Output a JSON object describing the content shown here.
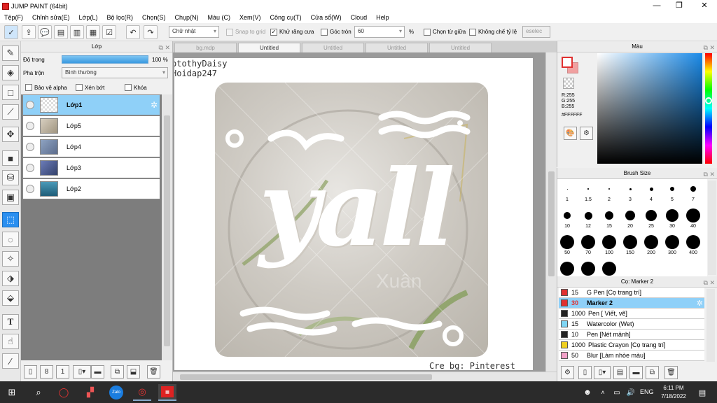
{
  "app": {
    "title": "JUMP PAINT (64bit)"
  },
  "menu": [
    "Tệp(F)",
    "Chỉnh sửa(E)",
    "Lớp(L)",
    "Bộ lọc(R)",
    "Chọn(S)",
    "Chụp(N)",
    "Màu (C)",
    "Xem(V)",
    "Công cụ(T)",
    "Cửa sổ(W)",
    "Cloud",
    "Help"
  ],
  "toolbar": {
    "shape_select": "Chữ nhật",
    "snap_label": "Snap to grid",
    "antialias_label": "Khử răng cưa",
    "round_label": "Góc tròn",
    "round_value": "60",
    "percent": "%",
    "select_center_label": "Chọn từ giữa",
    "no_ratio_label": "Không chế tỷ lệ",
    "deselect_label": "eselec"
  },
  "layer_panel": {
    "title": "Lớp",
    "opacity_label": "Độ trong",
    "opacity_value": "100 %",
    "blend_label": "Pha trộn",
    "blend_value": "Bình thường",
    "protect_alpha": "Bảo vệ alpha",
    "clip": "Xén bớt",
    "lock": "Khóa",
    "layers": [
      {
        "name": "Lớp1",
        "selected": true
      },
      {
        "name": "Lớp5",
        "selected": false
      },
      {
        "name": "Lớp4",
        "selected": false
      },
      {
        "name": "Lớp3",
        "selected": false
      },
      {
        "name": "Lớp2",
        "selected": false
      }
    ]
  },
  "tabs": [
    {
      "label": "bg.mdp",
      "active": false
    },
    {
      "label": "Untitled",
      "active": true
    },
    {
      "label": "Untitled",
      "active": false
    },
    {
      "label": "Untitled",
      "active": false
    },
    {
      "label": "Untitled",
      "active": false
    }
  ],
  "canvas": {
    "text_line1": "otothyDaisy",
    "text_line2": "Hoidap247",
    "main_text": "yall",
    "watermark": "Xuân",
    "credit": "Cre bg: Pinterest"
  },
  "color_panel": {
    "title": "Màu",
    "r": "R:255",
    "g": "G:255",
    "b": "B:255",
    "hex": "#FFFFFF"
  },
  "brush_panel": {
    "title": "Brush Size",
    "sizes": [
      "1",
      "1.5",
      "2",
      "3",
      "4",
      "5",
      "7",
      "10",
      "12",
      "15",
      "20",
      "25",
      "30",
      "40",
      "50",
      "70",
      "100",
      "150",
      "200",
      "300",
      "400"
    ]
  },
  "pen_panel": {
    "title": "Cọ: Marker 2",
    "items": [
      {
        "size": "15",
        "name": "G Pen [Cọ trang trí]",
        "color": "#e03030",
        "selected": false
      },
      {
        "size": "30",
        "name": "Marker 2",
        "color": "#e03030",
        "selected": true
      },
      {
        "size": "1000",
        "name": "Pen [ Viết, vẽ]",
        "color": "#222222",
        "selected": false
      },
      {
        "size": "15",
        "name": "Watercolor (Wet)",
        "color": "#7fd6f5",
        "selected": false
      },
      {
        "size": "10",
        "name": "Pen [Nét mảnh]",
        "color": "#222222",
        "selected": false
      },
      {
        "size": "1000",
        "name": "Plastic Crayon [Cọ trang trí]",
        "color": "#f0d020",
        "selected": false
      },
      {
        "size": "50",
        "name": "Blur [Làm nhòe màu]",
        "color": "#f2a0c8",
        "selected": false
      }
    ]
  },
  "taskbar": {
    "lang": "ENG",
    "time": "6:11 PM",
    "date": "7/18/2022",
    "zalo": "Zalo"
  }
}
